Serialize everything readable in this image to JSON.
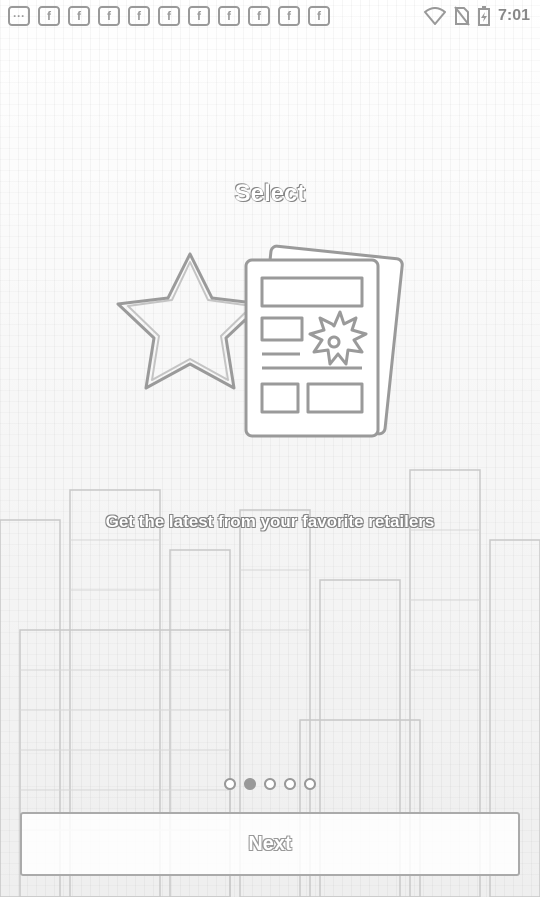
{
  "status_bar": {
    "time": "7:01",
    "notification_icons": [
      "more-icon",
      "facebook-icon",
      "facebook-icon",
      "facebook-icon",
      "facebook-icon",
      "facebook-icon",
      "facebook-icon",
      "facebook-icon",
      "facebook-icon",
      "facebook-icon",
      "facebook-icon"
    ],
    "system_icons": [
      "wifi-icon",
      "no-sim-icon",
      "battery-charging-icon"
    ]
  },
  "onboarding": {
    "title": "Select",
    "tagline": "Get the latest from your favorite retailers",
    "illustration_icon": "star-and-coupon-icon",
    "page_count": 5,
    "active_page_index": 1,
    "next_label": "Next"
  }
}
